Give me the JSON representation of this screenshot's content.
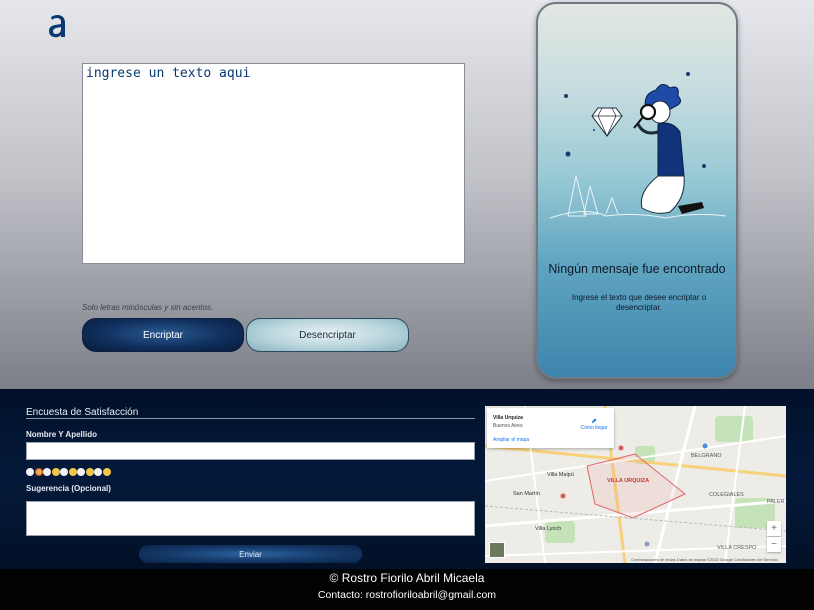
{
  "main": {
    "logo_text": "a",
    "textarea_placeholder": "ingrese un texto aqui",
    "hint": "Solo letras minúsculas y sin acentos.",
    "encrypt_label": "Encriptar",
    "decrypt_label": "Desencriptar"
  },
  "panel": {
    "title": "Ningún mensaje fue encontrado",
    "subtitle": "Ingrese el texto que desee encriptar o desencriptar."
  },
  "survey": {
    "title": "Encuesta de Satisfacción",
    "name_label": "Nombre Y Apellido",
    "rating_glyphs": [
      "😍",
      "😊",
      "😐",
      "😕",
      "😞",
      "😠",
      "😏",
      "😴",
      "😉",
      "😜"
    ],
    "suggestion_label": "Sugerencia (Opcional)",
    "submit_label": "Enviar"
  },
  "map": {
    "place_name": "Villa Urquiza",
    "place_region": "Buenos Aires",
    "directions_label": "Cómo llegar",
    "enlarge_label": "Ampliar el mapa",
    "labels": [
      "VILLA URQUIZA",
      "BELGRANO",
      "COLEGIALES",
      "VILLA CRESPO",
      "PALER",
      "San Martín",
      "Villa Maipú",
      "Villa Lynch"
    ],
    "footer": "Combinaciones de teclas   Datos de mapas ©2022 Google   Condiciones del Servicio"
  },
  "footer": {
    "credit": "© Rostro Fiorilo Abril Micaela",
    "contact": "Contacto: rostrofioriloabril@gmail.com"
  }
}
